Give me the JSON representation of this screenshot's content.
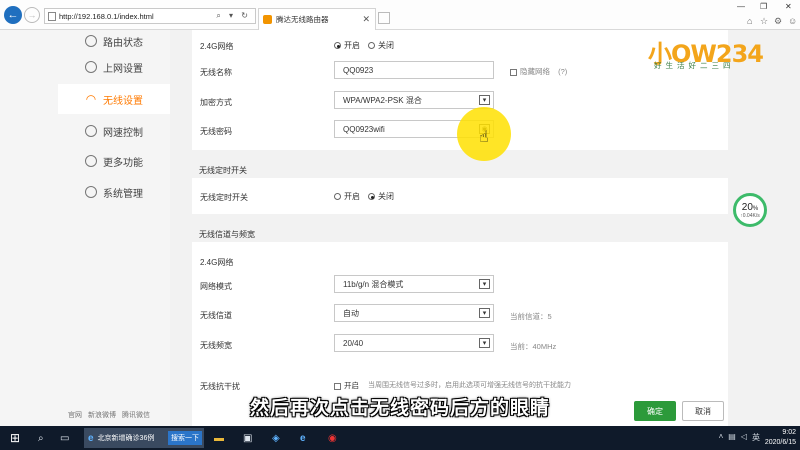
{
  "browser": {
    "url": "http://192.168.0.1/index.html",
    "tab_title": "腾达无线路由器",
    "address_tools": "⌕ ▾ ↻"
  },
  "sidebar": {
    "items": [
      {
        "label": "路由状态",
        "icon": "status-icon"
      },
      {
        "label": "上网设置",
        "icon": "globe-icon"
      },
      {
        "label": "无线设置",
        "icon": "wifi-icon"
      },
      {
        "label": "网速控制",
        "icon": "speed-icon"
      },
      {
        "label": "更多功能",
        "icon": "grid-icon"
      },
      {
        "label": "系统管理",
        "icon": "gear-icon"
      }
    ],
    "active_index": 2,
    "footer": [
      "官网",
      "新浪微博",
      "腾讯微信"
    ]
  },
  "wireless": {
    "band_label": "2.4G网络",
    "band_on": "开启",
    "band_off": "关闭",
    "ssid_label": "无线名称",
    "ssid_value": "QQ0923",
    "hide_label": "隐藏网络",
    "hide_help": "(?)",
    "encrypt_label": "加密方式",
    "encrypt_value": "WPA/WPA2-PSK 混合",
    "password_label": "无线密码",
    "password_value": "QQ0923wifi"
  },
  "schedule": {
    "title": "无线定时开关",
    "label": "无线定时开关",
    "on": "开启",
    "off": "关闭"
  },
  "channel": {
    "title": "无线信道与频宽",
    "band_label": "2.4G网络",
    "mode_label": "网络模式",
    "mode_value": "11b/g/n 混合模式",
    "channel_label": "无线信道",
    "channel_value": "自动",
    "channel_current": "当前信道：5",
    "width_label": "无线频宽",
    "width_value": "20/40",
    "width_current": "当前：40MHz",
    "anti_label": "无线抗干扰",
    "anti_on": "开启",
    "anti_hint": "当周围无线信号过多时，启用此选项可增强无线信号的抗干扰能力"
  },
  "buttons": {
    "ok": "确定",
    "cancel": "取消"
  },
  "logo": {
    "text": "小OW234",
    "sub": "好生活好二三四"
  },
  "speed_widget": {
    "percent": "20",
    "unit": "%",
    "rate": "↑0.04K/s"
  },
  "subtitle": "然后再次点击无线密码后方的眼睛",
  "taskbar": {
    "task_label": "北京新增确诊36例",
    "search_btn": "搜索一下",
    "ime": "英",
    "date": "2020/6/15",
    "time": "9:02"
  },
  "colors": {
    "accent": "#ff7a00",
    "ok_button": "#2c9a3a",
    "highlight": "#ffe100"
  }
}
